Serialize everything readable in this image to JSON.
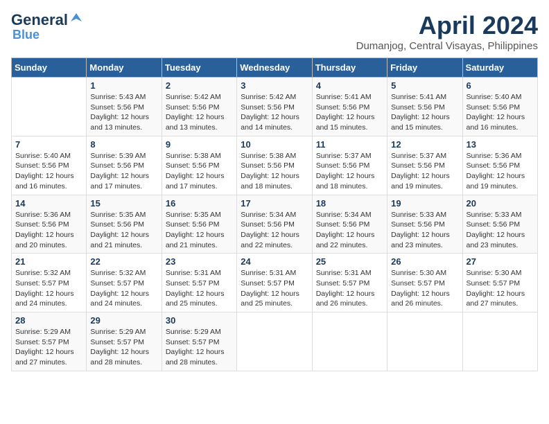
{
  "header": {
    "logo_general": "General",
    "logo_blue": "Blue",
    "month_title": "April 2024",
    "location": "Dumanjog, Central Visayas, Philippines"
  },
  "days_of_week": [
    "Sunday",
    "Monday",
    "Tuesday",
    "Wednesday",
    "Thursday",
    "Friday",
    "Saturday"
  ],
  "weeks": [
    [
      {
        "day": "",
        "info": ""
      },
      {
        "day": "1",
        "info": "Sunrise: 5:43 AM\nSunset: 5:56 PM\nDaylight: 12 hours\nand 13 minutes."
      },
      {
        "day": "2",
        "info": "Sunrise: 5:42 AM\nSunset: 5:56 PM\nDaylight: 12 hours\nand 13 minutes."
      },
      {
        "day": "3",
        "info": "Sunrise: 5:42 AM\nSunset: 5:56 PM\nDaylight: 12 hours\nand 14 minutes."
      },
      {
        "day": "4",
        "info": "Sunrise: 5:41 AM\nSunset: 5:56 PM\nDaylight: 12 hours\nand 15 minutes."
      },
      {
        "day": "5",
        "info": "Sunrise: 5:41 AM\nSunset: 5:56 PM\nDaylight: 12 hours\nand 15 minutes."
      },
      {
        "day": "6",
        "info": "Sunrise: 5:40 AM\nSunset: 5:56 PM\nDaylight: 12 hours\nand 16 minutes."
      }
    ],
    [
      {
        "day": "7",
        "info": "Sunrise: 5:40 AM\nSunset: 5:56 PM\nDaylight: 12 hours\nand 16 minutes."
      },
      {
        "day": "8",
        "info": "Sunrise: 5:39 AM\nSunset: 5:56 PM\nDaylight: 12 hours\nand 17 minutes."
      },
      {
        "day": "9",
        "info": "Sunrise: 5:38 AM\nSunset: 5:56 PM\nDaylight: 12 hours\nand 17 minutes."
      },
      {
        "day": "10",
        "info": "Sunrise: 5:38 AM\nSunset: 5:56 PM\nDaylight: 12 hours\nand 18 minutes."
      },
      {
        "day": "11",
        "info": "Sunrise: 5:37 AM\nSunset: 5:56 PM\nDaylight: 12 hours\nand 18 minutes."
      },
      {
        "day": "12",
        "info": "Sunrise: 5:37 AM\nSunset: 5:56 PM\nDaylight: 12 hours\nand 19 minutes."
      },
      {
        "day": "13",
        "info": "Sunrise: 5:36 AM\nSunset: 5:56 PM\nDaylight: 12 hours\nand 19 minutes."
      }
    ],
    [
      {
        "day": "14",
        "info": "Sunrise: 5:36 AM\nSunset: 5:56 PM\nDaylight: 12 hours\nand 20 minutes."
      },
      {
        "day": "15",
        "info": "Sunrise: 5:35 AM\nSunset: 5:56 PM\nDaylight: 12 hours\nand 21 minutes."
      },
      {
        "day": "16",
        "info": "Sunrise: 5:35 AM\nSunset: 5:56 PM\nDaylight: 12 hours\nand 21 minutes."
      },
      {
        "day": "17",
        "info": "Sunrise: 5:34 AM\nSunset: 5:56 PM\nDaylight: 12 hours\nand 22 minutes."
      },
      {
        "day": "18",
        "info": "Sunrise: 5:34 AM\nSunset: 5:56 PM\nDaylight: 12 hours\nand 22 minutes."
      },
      {
        "day": "19",
        "info": "Sunrise: 5:33 AM\nSunset: 5:56 PM\nDaylight: 12 hours\nand 23 minutes."
      },
      {
        "day": "20",
        "info": "Sunrise: 5:33 AM\nSunset: 5:56 PM\nDaylight: 12 hours\nand 23 minutes."
      }
    ],
    [
      {
        "day": "21",
        "info": "Sunrise: 5:32 AM\nSunset: 5:57 PM\nDaylight: 12 hours\nand 24 minutes."
      },
      {
        "day": "22",
        "info": "Sunrise: 5:32 AM\nSunset: 5:57 PM\nDaylight: 12 hours\nand 24 minutes."
      },
      {
        "day": "23",
        "info": "Sunrise: 5:31 AM\nSunset: 5:57 PM\nDaylight: 12 hours\nand 25 minutes."
      },
      {
        "day": "24",
        "info": "Sunrise: 5:31 AM\nSunset: 5:57 PM\nDaylight: 12 hours\nand 25 minutes."
      },
      {
        "day": "25",
        "info": "Sunrise: 5:31 AM\nSunset: 5:57 PM\nDaylight: 12 hours\nand 26 minutes."
      },
      {
        "day": "26",
        "info": "Sunrise: 5:30 AM\nSunset: 5:57 PM\nDaylight: 12 hours\nand 26 minutes."
      },
      {
        "day": "27",
        "info": "Sunrise: 5:30 AM\nSunset: 5:57 PM\nDaylight: 12 hours\nand 27 minutes."
      }
    ],
    [
      {
        "day": "28",
        "info": "Sunrise: 5:29 AM\nSunset: 5:57 PM\nDaylight: 12 hours\nand 27 minutes."
      },
      {
        "day": "29",
        "info": "Sunrise: 5:29 AM\nSunset: 5:57 PM\nDaylight: 12 hours\nand 28 minutes."
      },
      {
        "day": "30",
        "info": "Sunrise: 5:29 AM\nSunset: 5:57 PM\nDaylight: 12 hours\nand 28 minutes."
      },
      {
        "day": "",
        "info": ""
      },
      {
        "day": "",
        "info": ""
      },
      {
        "day": "",
        "info": ""
      },
      {
        "day": "",
        "info": ""
      }
    ]
  ]
}
